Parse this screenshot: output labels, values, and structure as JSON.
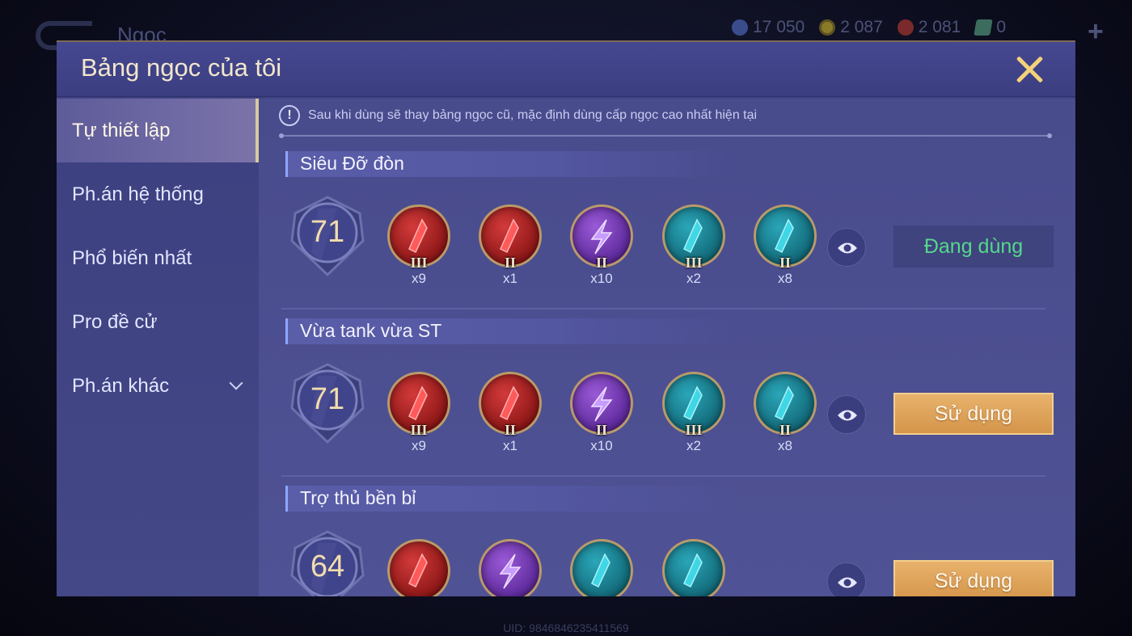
{
  "background": {
    "title": "Ngọc",
    "currencies": [
      {
        "icon": "blue-gem-icon",
        "value": "17 050"
      },
      {
        "icon": "gold-coin-icon",
        "value": "2 087"
      },
      {
        "icon": "red-gem-icon",
        "value": "2 081"
      },
      {
        "icon": "voucher-card-icon",
        "value": "0"
      }
    ],
    "uid": "UID: 9846846235411569"
  },
  "modal": {
    "title": "Bảng ngọc của tôi",
    "notice": "Sau khi dùng sẽ thay bảng ngọc cũ, mặc định dùng cấp ngọc cao nhất hiện tại",
    "notice_icon": "!"
  },
  "sidebar": {
    "items": [
      {
        "label": "Tự thiết lập",
        "active": true
      },
      {
        "label": "Ph.án hệ thống"
      },
      {
        "label": "Phổ biến nhất"
      },
      {
        "label": "Pro đề cử"
      },
      {
        "label": "Ph.án khác",
        "has_dropdown": true
      }
    ]
  },
  "sets": [
    {
      "name": "Siêu Đỡ đòn",
      "level": "71",
      "action": "Đang dùng",
      "action_state": "in-use",
      "runes": [
        {
          "color": "red",
          "tier": "III",
          "count": "x9"
        },
        {
          "color": "red",
          "tier": "II",
          "count": "x1"
        },
        {
          "color": "purple",
          "tier": "II",
          "count": "x10"
        },
        {
          "color": "blue",
          "tier": "III",
          "count": "x2"
        },
        {
          "color": "blue",
          "tier": "II",
          "count": "x8"
        }
      ]
    },
    {
      "name": "Vừa tank vừa ST",
      "level": "71",
      "action": "Sử dụng",
      "action_state": "available",
      "runes": [
        {
          "color": "red",
          "tier": "III",
          "count": "x9"
        },
        {
          "color": "red",
          "tier": "II",
          "count": "x1"
        },
        {
          "color": "purple",
          "tier": "II",
          "count": "x10"
        },
        {
          "color": "blue",
          "tier": "III",
          "count": "x2"
        },
        {
          "color": "blue",
          "tier": "II",
          "count": "x8"
        }
      ]
    },
    {
      "name": "Trợ thủ bền bỉ",
      "level": "64",
      "action": "Sử dụng",
      "action_state": "available",
      "runes": [
        {
          "color": "red",
          "tier": "",
          "count": ""
        },
        {
          "color": "purple",
          "tier": "",
          "count": ""
        },
        {
          "color": "blue",
          "tier": "",
          "count": ""
        },
        {
          "color": "blue",
          "tier": "",
          "count": ""
        }
      ]
    }
  ],
  "colors": {
    "in_use_text": "#55d88a",
    "use_button": "#dca15a",
    "title_text": "#f2e6cc"
  }
}
